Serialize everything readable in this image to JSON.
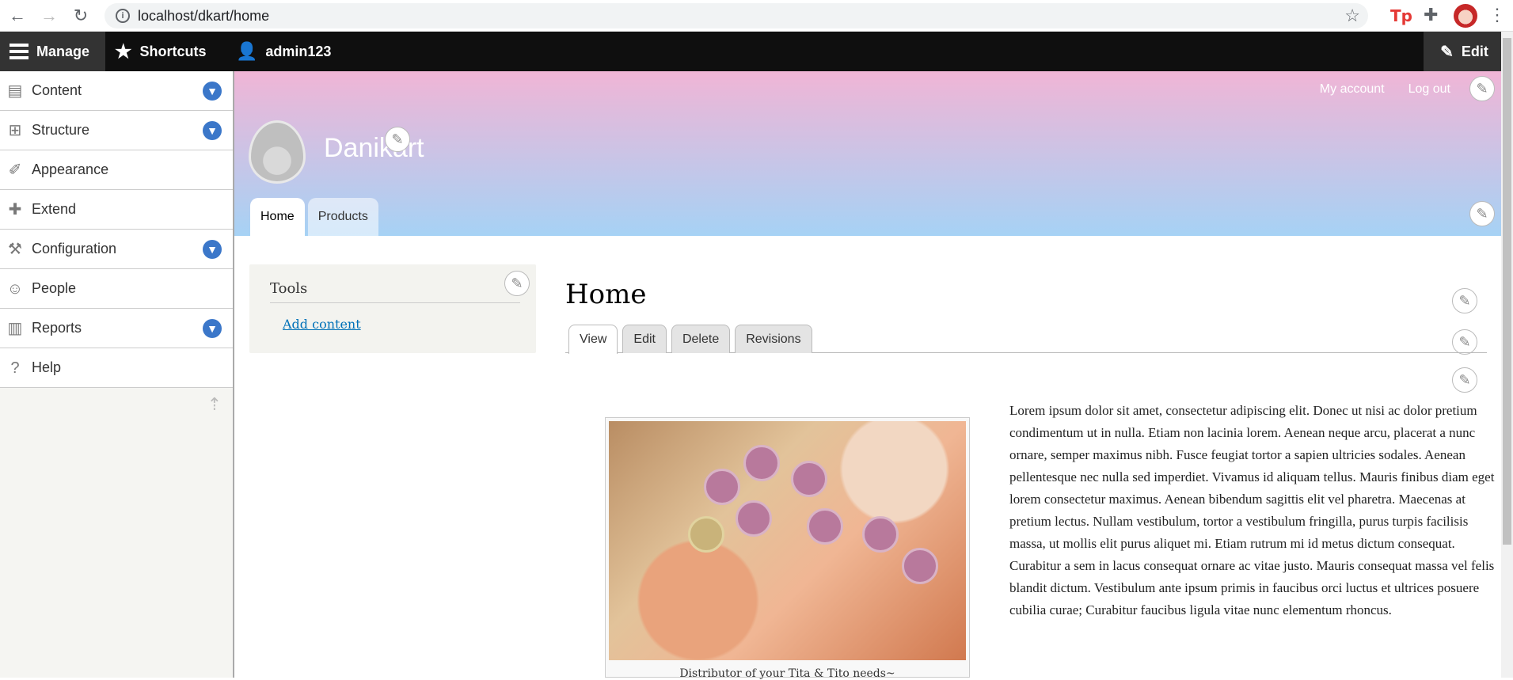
{
  "browser": {
    "url": "localhost/dkart/home"
  },
  "toolbar": {
    "manage": "Manage",
    "shortcuts": "Shortcuts",
    "user": "admin123",
    "edit": "Edit"
  },
  "sidebar": {
    "items": [
      {
        "label": "Content",
        "icon": "file-icon",
        "expandable": true
      },
      {
        "label": "Structure",
        "icon": "sitemap-icon",
        "expandable": true
      },
      {
        "label": "Appearance",
        "icon": "paintbrush-icon",
        "expandable": false
      },
      {
        "label": "Extend",
        "icon": "puzzle-icon",
        "expandable": false
      },
      {
        "label": "Configuration",
        "icon": "wrench-icon",
        "expandable": true
      },
      {
        "label": "People",
        "icon": "people-icon",
        "expandable": false
      },
      {
        "label": "Reports",
        "icon": "bar-chart-icon",
        "expandable": true
      },
      {
        "label": "Help",
        "icon": "help-icon",
        "expandable": false
      }
    ]
  },
  "header": {
    "links": [
      "My account",
      "Log out"
    ],
    "site_name": "Danikart",
    "tabs": [
      "Home",
      "Products"
    ]
  },
  "tools": {
    "title": "Tools",
    "link": "Add content"
  },
  "main": {
    "title": "Home",
    "tabs": [
      "View",
      "Edit",
      "Delete",
      "Revisions"
    ],
    "caption": "Distributor of your Tita & Tito needs~",
    "body": "Lorem ipsum dolor sit amet, consectetur adipiscing elit. Donec ut nisi ac dolor pretium condimentum ut in nulla. Etiam non lacinia lorem. Aenean neque arcu, placerat a nunc ornare, semper maximus nibh. Fusce feugiat tortor a sapien ultricies sodales. Aenean pellentesque nec nulla sed imperdiet. Vivamus id aliquam tellus. Mauris finibus diam eget lorem consectetur maximus. Aenean bibendum sagittis elit vel pharetra. Maecenas at pretium lectus. Nullam vestibulum, tortor a vestibulum fringilla, purus turpis facilisis massa, ut mollis elit purus aliquet mi. Etiam rutrum mi id metus dictum consequat. Curabitur a sem in lacus consequat ornare ac vitae justo. Mauris consequat massa vel felis blandit dictum. Vestibulum ante ipsum primis in faucibus orci luctus et ultrices posuere cubilia curae; Curabitur faucibus ligula vitae nunc elementum rhoncus."
  }
}
